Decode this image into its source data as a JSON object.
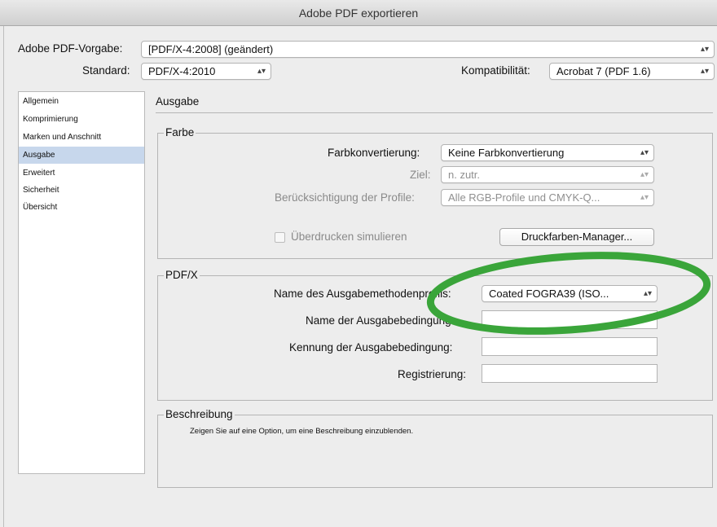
{
  "window": {
    "title": "Adobe PDF exportieren"
  },
  "top": {
    "preset_label": "Adobe PDF-Vorgabe:",
    "preset_value": "[PDF/X-4:2008] (geändert)",
    "standard_label": "Standard:",
    "standard_value": "PDF/X-4:2010",
    "compat_label": "Kompatibilität:",
    "compat_value": "Acrobat 7 (PDF 1.6)"
  },
  "sidebar": {
    "items": [
      {
        "label": "Allgemein"
      },
      {
        "label": "Komprimierung"
      },
      {
        "label": "Marken und Anschnitt"
      },
      {
        "label": "Ausgabe"
      },
      {
        "label": "Erweitert"
      },
      {
        "label": "Sicherheit"
      },
      {
        "label": "Übersicht"
      }
    ],
    "selected": "Ausgabe"
  },
  "main": {
    "title": "Ausgabe",
    "farbe": {
      "label": "Farbe",
      "conversion_label": "Farbkonvertierung:",
      "conversion_value": "Keine Farbkonvertierung",
      "target_label": "Ziel:",
      "target_value": "n. zutr.",
      "profiles_label": "Berücksichtigung der Profile:",
      "profiles_value": "Alle RGB-Profile und CMYK-Q...",
      "overprint_label": "Überdrucken simulieren",
      "ink_manager_label": "Druckfarben-Manager..."
    },
    "pdfx": {
      "label": "PDF/X",
      "profile_name_label": "Name des Ausgabemethodenprofils:",
      "profile_name_value": "Coated FOGRA39 (ISO...",
      "condition_name_label": "Name der Ausgabebedingung:",
      "condition_id_label": "Kennung der Ausgabebedingung:",
      "registry_label": "Registrierung:"
    },
    "beschreibung": {
      "label": "Beschreibung",
      "text": "Zeigen Sie auf eine Option, um eine Beschreibung einzublenden."
    }
  },
  "annotation": {
    "color": "#3aa53a"
  },
  "icons": {
    "select_arrows": "⇕"
  }
}
